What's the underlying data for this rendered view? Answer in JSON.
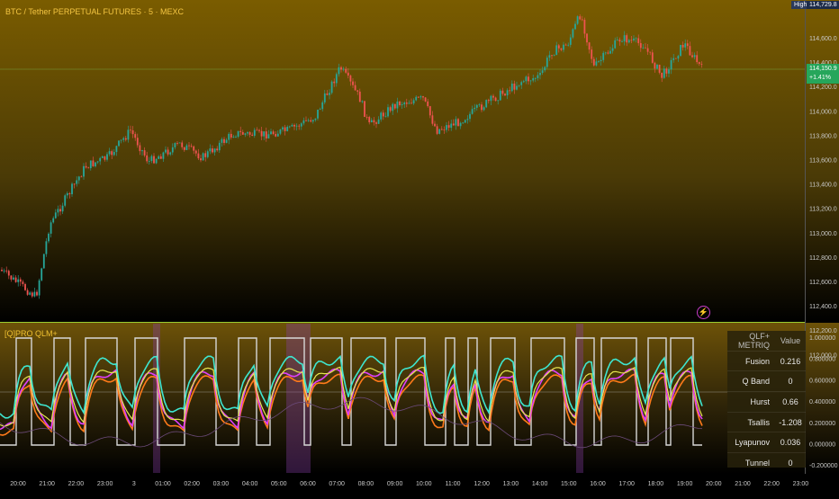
{
  "chart_title": "BTC / Tether PERPETUAL FUTURES · 5 · MEXC",
  "indicator_label": "[Q]PRO QLM+",
  "high_tag": "High",
  "high_value": "114,729.8",
  "price_tag": {
    "value": "114,150.9",
    "change": "+1.41%"
  },
  "price_axis": [
    "114,600.0",
    "114,400.0",
    "114,200.0",
    "114,000.0",
    "113,800.0",
    "113,600.0",
    "113,400.0",
    "113,200.0",
    "113,000.0",
    "112,800.0",
    "112,600.0",
    "112,400.0",
    "112,200.0",
    "112,000.0"
  ],
  "indicator_axis": [
    "1.000000",
    "0.800000",
    "0.600000",
    "0.400000",
    "0.200000",
    "0.000000",
    "-0.200000"
  ],
  "time_axis": [
    "20:00",
    "21:00",
    "22:00",
    "23:00",
    "3",
    "01:00",
    "02:00",
    "03:00",
    "04:00",
    "05:00",
    "06:00",
    "07:00",
    "08:00",
    "09:00",
    "10:00",
    "11:00",
    "12:00",
    "13:00",
    "14:00",
    "15:00",
    "16:00",
    "17:00",
    "18:00",
    "19:00",
    "20:00",
    "21:00",
    "22:00",
    "23:00"
  ],
  "metrics_table": {
    "header": {
      "label": "QLF+ METRIQ",
      "value": "Value"
    },
    "rows": [
      {
        "label": "Fusion",
        "value": "0.216"
      },
      {
        "label": "Q Band",
        "value": "0"
      },
      {
        "label": "Hurst",
        "value": "0.66"
      },
      {
        "label": "Tsallis",
        "value": "-1.208"
      },
      {
        "label": "Lyapunov",
        "value": "0.036"
      },
      {
        "label": "Tunnel",
        "value": "0"
      }
    ]
  },
  "colors": {
    "up": "#26a69a",
    "down": "#ef5350",
    "gold": "#f1c232",
    "cyan": "#3ee6d0",
    "magenta": "#e040fb",
    "orange": "#ff7a1a",
    "yellow": "#e6e650",
    "band": "#d8d8d8"
  }
}
